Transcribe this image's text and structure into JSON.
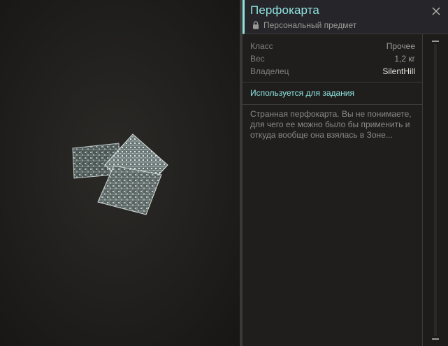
{
  "item": {
    "title": "Перфокарта",
    "subtitle": "Персональный предмет",
    "properties": [
      {
        "label": "Класс",
        "value": "Прочее"
      },
      {
        "label": "Вес",
        "value": "1,2 кг"
      },
      {
        "label": "Владелец",
        "value": "SilentHill"
      }
    ],
    "quest_note": "Используется для задания",
    "description": "Странная перфокарта. Вы не понимаете, для чего ее можно было бы применить и откуда вообще она взялась в Зоне..."
  },
  "icons": {
    "lock": "lock-icon",
    "close": "close-icon",
    "item_image": "circuit-board-cards-image"
  },
  "colors": {
    "accent": "#8fe3e0",
    "background": "#1f1e1c"
  }
}
